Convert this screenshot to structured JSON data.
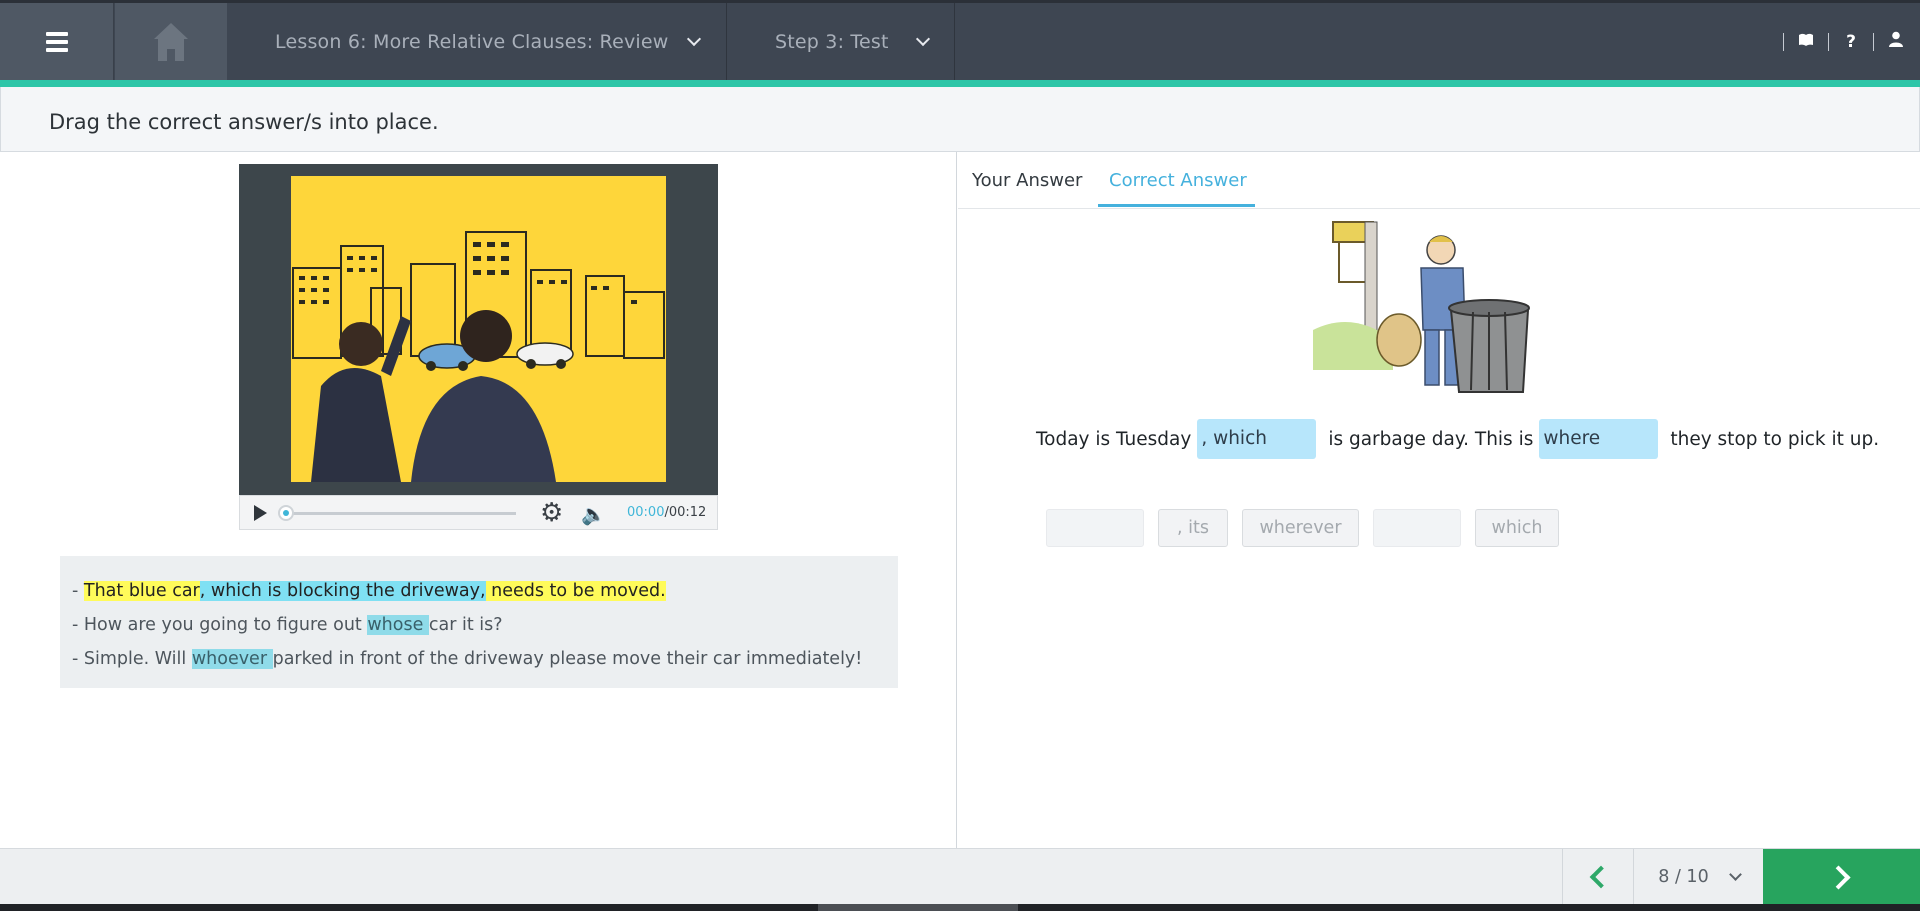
{
  "header": {
    "lesson_label": "Lesson 6: More Relative Clauses: Review",
    "step_label": "Step 3: Test",
    "icons": [
      "menu-icon",
      "home-icon",
      "book-icon",
      "help-icon",
      "user-icon"
    ],
    "help_glyph": "?"
  },
  "instruction": "Drag the correct answer/s into place.",
  "video": {
    "time_current": "00:00",
    "time_separator": "/",
    "time_total": "00:12",
    "progress": 0
  },
  "transcript": {
    "line1": {
      "dash": "- ",
      "a": "That blue car",
      "b": ", which is blocking the driveway,",
      "c": " needs to be moved."
    },
    "line2": {
      "pre": "- How are you going to figure out ",
      "hl": "whose ",
      "post": "car it is?"
    },
    "line3": {
      "pre": "- Simple. Will ",
      "hl": "whoever ",
      "post": "parked in front of the driveway please move their car immediately!"
    }
  },
  "tabs": {
    "your_answer": "Your Answer",
    "correct_answer": "Correct Answer",
    "active": "Correct Answer"
  },
  "sentence": {
    "part1": "Today is Tuesday",
    "blank1": ", which",
    "part2": "is garbage day. This is",
    "blank2": "where",
    "part3": "they stop to pick it up."
  },
  "word_bank": {
    "chip2": ", its",
    "chip3": "wherever",
    "chip5": "which"
  },
  "footer": {
    "page_label": "8 / 10",
    "current_page": 8,
    "total_pages": 10
  },
  "colors": {
    "topbar": "#3e4652",
    "accent": "#2ec6a8",
    "tab_active": "#45b1dd",
    "blank_fill": "#b7e6fb",
    "next_button": "#27a45e",
    "highlight_yellow": "#fffb5a",
    "highlight_cyan": "#7fe0f3"
  }
}
